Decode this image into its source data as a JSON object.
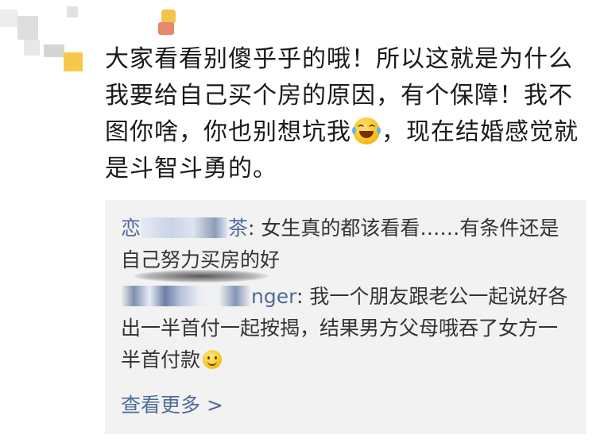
{
  "comment": {
    "text_part1": "大家看看别傻乎乎的哦！所以这就是为什么我要给自己买个房的原因，有个保障！我不图你啥，你也别想坑我",
    "emoji": "laughing-tears-emoji",
    "text_part2": "，现在结婚感觉就是斗智斗勇的。"
  },
  "replies": [
    {
      "user_prefix": "恋",
      "user_suffix": "茶",
      "separator": ":",
      "text": " 女生真的都该看看……有条件还是自己努力买房的好"
    },
    {
      "user_prefix": "",
      "user_suffix": "nger",
      "separator": ":",
      "text": " 我一个朋友跟老公一起说好各出一半首付一起按揭，结果男方父母哦吞了女方一半首付款",
      "emoji": "smile-emoji"
    }
  ],
  "more_link": "查看更多 >",
  "colors": {
    "link": "#4e6b9a",
    "reply_bg": "#f2f2f2",
    "text": "#1a1a1a"
  }
}
